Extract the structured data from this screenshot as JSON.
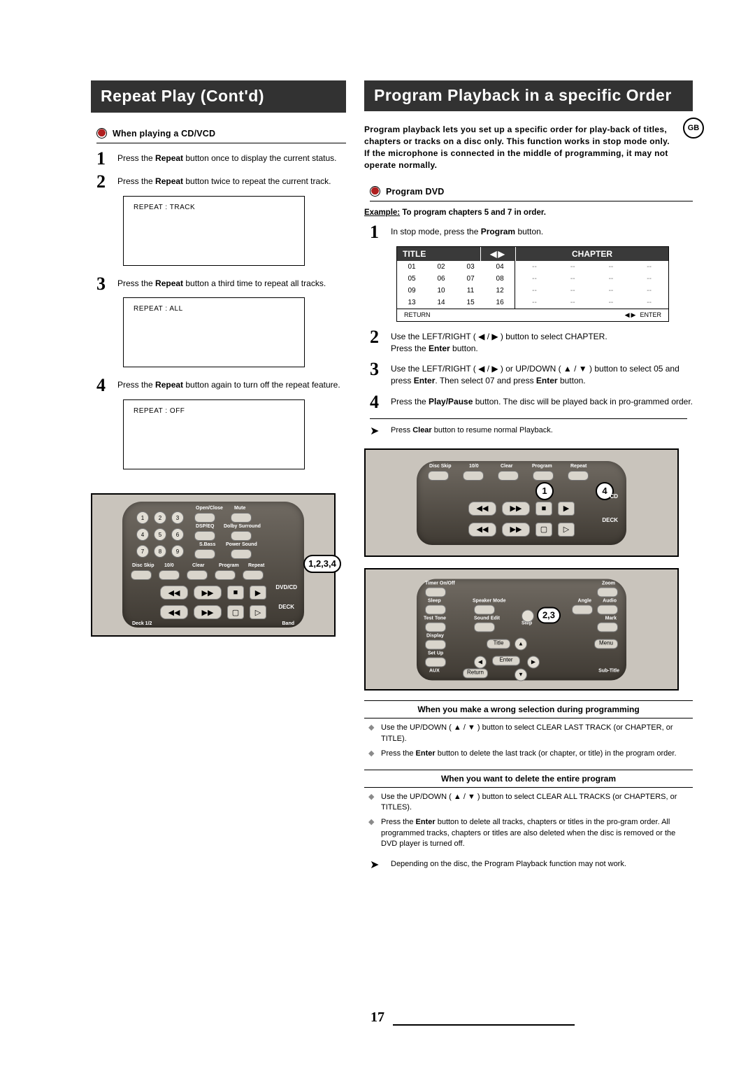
{
  "left": {
    "title": "Repeat Play (Cont'd)",
    "heading": "When playing a CD/VCD",
    "steps": [
      {
        "n": "1",
        "pre": "Press the ",
        "bold": "Repeat",
        "post": " button once to display the current status."
      },
      {
        "n": "2",
        "pre": "Press the ",
        "bold": "Repeat",
        "post": " button twice to repeat the current track."
      },
      {
        "n": "3",
        "pre": "Press the ",
        "bold": "Repeat",
        "post": " button a third time to repeat all tracks."
      },
      {
        "n": "4",
        "pre": "Press the ",
        "bold": "Repeat",
        "post": " button again to turn off the repeat feature."
      }
    ],
    "screens": [
      "REPEAT : TRACK",
      "REPEAT : ALL",
      "REPEAT : OFF"
    ],
    "remote": {
      "top_labels_row1": [
        "Open/Close",
        "Mute"
      ],
      "top_labels_row2": [
        "DSP/EQ",
        "Dolby Surround"
      ],
      "top_labels_row3": [
        "S.Bass",
        "Power Sound"
      ],
      "num_pad": [
        "1",
        "2",
        "3",
        "4",
        "5",
        "6",
        "7",
        "8",
        "9"
      ],
      "row_labels": [
        "Disc Skip",
        "10/0",
        "Clear",
        "Program",
        "Repeat"
      ],
      "right_labels": [
        "DVD/CD",
        "DECK"
      ],
      "bottom_left": "Deck 1/2",
      "bottom_right": "Band",
      "callout": "1,2,3,4"
    }
  },
  "right": {
    "title": "Program Playback in a specific Order",
    "gb": "GB",
    "intro": "Program playback lets you set up a specific order for play-back of titles, chapters or tracks on a disc only. This function works in stop mode only.\nIf the microphone is connected in the middle of programming, it may not operate normally.",
    "heading": "Program DVD",
    "example_u": "Example:",
    "example_rest": " To program chapters 5 and 7 in order.",
    "steps": [
      {
        "n": "1",
        "html": "In stop mode, press the <b>Program</b> button."
      },
      {
        "n": "2",
        "html": "Use the LEFT/RIGHT ( ◀ / ▶ ) button to select CHAPTER.<br>Press the <b>Enter</b> button."
      },
      {
        "n": "3",
        "html": "Use the LEFT/RIGHT ( ◀ / ▶ ) or UP/DOWN ( ▲ / ▼ ) button to select 05 and press <b>Enter</b>. Then select 07 and press <b>Enter</b> button."
      },
      {
        "n": "4",
        "html": "Press the <b>Play/Pause</b> button. The disc will be played back in pro-grammed order."
      }
    ],
    "note1": "Press Clear button to resume normal Playback.",
    "table": {
      "title": "TITLE",
      "chapter": "CHAPTER",
      "left_cells": [
        "01",
        "02",
        "03",
        "04",
        "05",
        "06",
        "07",
        "08",
        "09",
        "10",
        "11",
        "12",
        "13",
        "14",
        "15",
        "16"
      ],
      "right_cells": [
        "--",
        "--",
        "--",
        "--",
        "--",
        "--",
        "--",
        "--",
        "--",
        "--",
        "--",
        "--",
        "--",
        "--",
        "--",
        "--"
      ],
      "return": "RETURN",
      "enter": "ENTER"
    },
    "remote1": {
      "row_labels": [
        "Disc Skip",
        "10/0",
        "Clear",
        "Program",
        "Repeat"
      ],
      "right_labels": [
        "CD",
        "DECK"
      ],
      "callout_left": "1",
      "callout_right": "4"
    },
    "remote2": {
      "left_col": [
        "Timer On/Off",
        "Sleep",
        "Test Tone",
        "Display",
        "Set Up",
        "AUX"
      ],
      "mid_col": [
        "Speaker Mode",
        "Sound Edit",
        "Title",
        "Return"
      ],
      "nav": [
        "◀",
        "Enter",
        "▶",
        "▲",
        "▼"
      ],
      "right_col": [
        "Zoom",
        "Angle",
        "Audio",
        "Mark",
        "Menu",
        "Sub-Title"
      ],
      "step_center": "Step",
      "callout": "2,3"
    },
    "wrong": {
      "title": "When you make a wrong selection during programming",
      "b1": "Use the UP/DOWN ( ▲ / ▼ ) button to select CLEAR LAST TRACK (or CHAPTER, or TITLE).",
      "b2": "Press the Enter button to delete the last track (or chapter, or title) in the program order."
    },
    "delete": {
      "title": "When you want to delete the entire program",
      "b1": "Use the UP/DOWN ( ▲ / ▼ ) button to select CLEAR ALL TRACKS (or CHAPTERS, or TITLES).",
      "b2": "Press the Enter button to delete all tracks, chapters or titles in the pro-gram order. All programmed tracks, chapters or titles are also deleted when the disc is removed or the DVD player is turned off."
    },
    "note2": "Depending on the disc, the Program Playback function may not work."
  },
  "page_no": "17"
}
